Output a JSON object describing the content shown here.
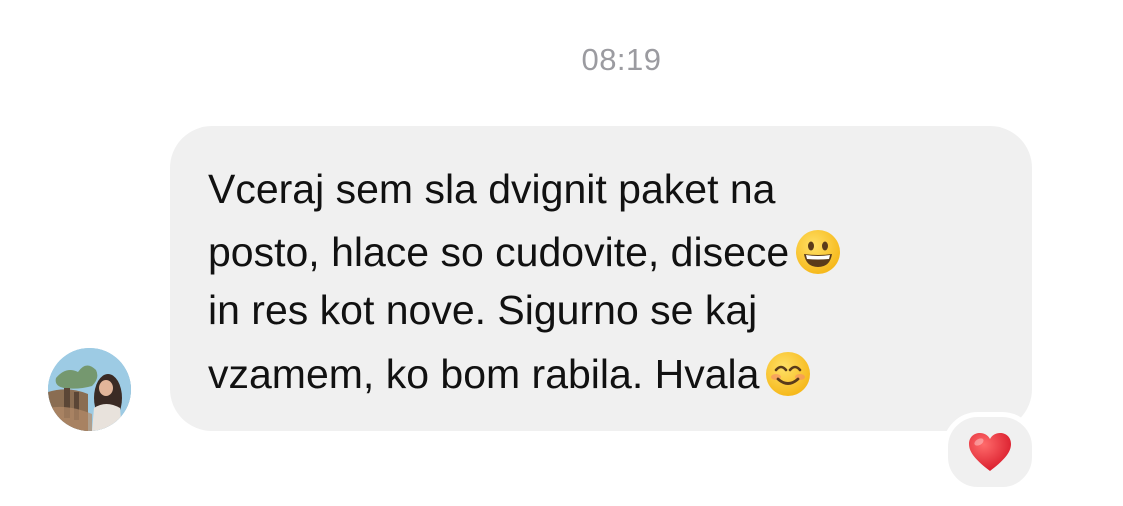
{
  "conversation": {
    "timestamp": "08:19",
    "message": {
      "lines": [
        "Vceraj sem sla dvignit paket na",
        "posto, hlace so cudovite, disece",
        "in res kot nove. Sigurno se kaj",
        "vzamem, ko bom rabila. Hvala"
      ],
      "bubble_color": "#f0f0f0",
      "text_color": "#111111"
    },
    "emojis": {
      "line2": "grinning-face-icon",
      "line4": "smiling-face-icon"
    },
    "reaction": {
      "icon": "red-heart-icon",
      "color": "#e0242f"
    }
  }
}
